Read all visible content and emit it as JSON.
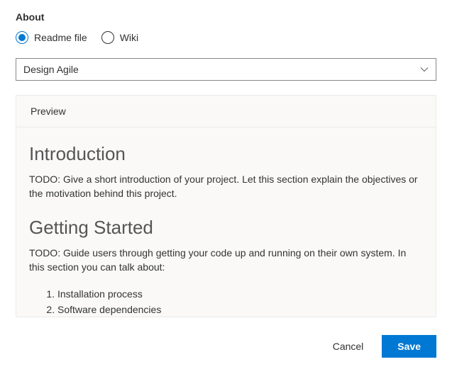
{
  "section_title": "About",
  "radio": {
    "readme_label": "Readme file",
    "wiki_label": "Wiki",
    "selected": "readme"
  },
  "dropdown": {
    "value": "Design Agile"
  },
  "preview": {
    "tab_label": "Preview",
    "heading1": "Introduction",
    "paragraph1": "TODO: Give a short introduction of your project. Let this section explain the objectives or the motivation behind this project.",
    "heading2": "Getting Started",
    "paragraph2": "TODO: Guide users through getting your code up and running on their own system. In this section you can talk about:",
    "list_item1": "Installation process",
    "list_item2": "Software dependencies"
  },
  "buttons": {
    "cancel": "Cancel",
    "save": "Save"
  }
}
